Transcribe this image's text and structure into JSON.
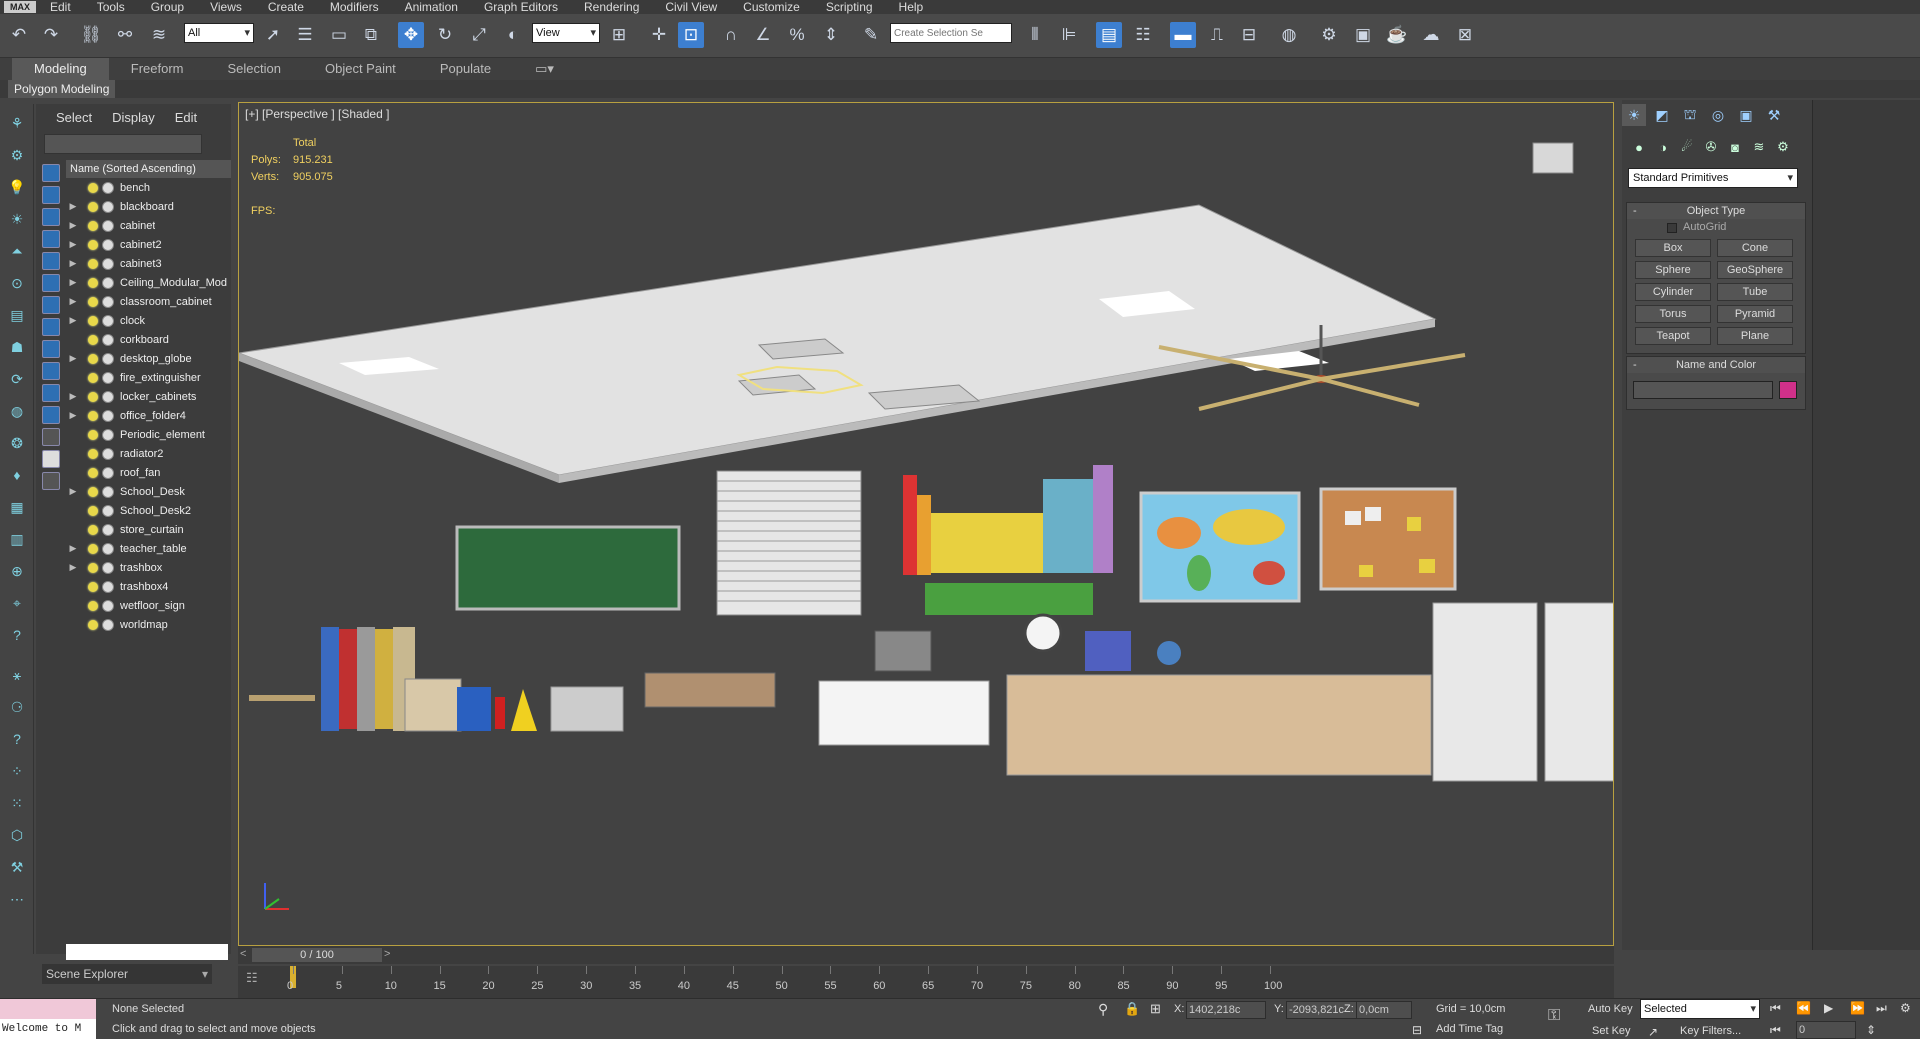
{
  "menu": {
    "logo": "MAX",
    "items": [
      "Edit",
      "Tools",
      "Group",
      "Views",
      "Create",
      "Modifiers",
      "Animation",
      "Graph Editors",
      "Rendering",
      "Civil View",
      "Customize",
      "Scripting",
      "Help"
    ]
  },
  "toolbar": {
    "filter_value": "All",
    "refcoord_value": "View",
    "selection_set_placeholder": "Create Selection Se"
  },
  "ribbon": {
    "tabs": [
      "Modeling",
      "Freeform",
      "Selection",
      "Object Paint",
      "Populate"
    ],
    "active": "Modeling",
    "sub_label": "Polygon Modeling"
  },
  "explorer": {
    "menu": [
      "Select",
      "Display",
      "Edit"
    ],
    "column_header": "Name (Sorted Ascending)",
    "items": [
      {
        "name": "bench",
        "expandable": false
      },
      {
        "name": "blackboard",
        "expandable": true
      },
      {
        "name": "cabinet",
        "expandable": true
      },
      {
        "name": "cabinet2",
        "expandable": true
      },
      {
        "name": "cabinet3",
        "expandable": true
      },
      {
        "name": "Ceiling_Modular_Mod",
        "expandable": true
      },
      {
        "name": "classroom_cabinet",
        "expandable": true
      },
      {
        "name": "clock",
        "expandable": true
      },
      {
        "name": "corkboard",
        "expandable": false
      },
      {
        "name": "desktop_globe",
        "expandable": true
      },
      {
        "name": "fire_extinguisher",
        "expandable": false
      },
      {
        "name": "locker_cabinets",
        "expandable": true
      },
      {
        "name": "office_folder4",
        "expandable": true
      },
      {
        "name": "Periodic_element",
        "expandable": false
      },
      {
        "name": "radiator2",
        "expandable": false
      },
      {
        "name": "roof_fan",
        "expandable": false
      },
      {
        "name": "School_Desk",
        "expandable": true
      },
      {
        "name": "School_Desk2",
        "expandable": false
      },
      {
        "name": "store_curtain",
        "expandable": false
      },
      {
        "name": "teacher_table",
        "expandable": true
      },
      {
        "name": "trashbox",
        "expandable": true
      },
      {
        "name": "trashbox4",
        "expandable": false
      },
      {
        "name": "wetfloor_sign",
        "expandable": false
      },
      {
        "name": "worldmap",
        "expandable": false
      }
    ],
    "footer_label": "Scene Explorer"
  },
  "viewport": {
    "label": "[+] [Perspective ] [Shaded ]",
    "stats_header": "Total",
    "polys_label": "Polys:",
    "polys_value": "915.231",
    "verts_label": "Verts:",
    "verts_value": "905.075",
    "fps_label": "FPS:"
  },
  "command_panel": {
    "primitives_value": "Standard Primitives",
    "object_type_title": "Object Type",
    "autogrid_label": "AutoGrid",
    "buttons": [
      "Box",
      "Cone",
      "Sphere",
      "GeoSphere",
      "Cylinder",
      "Tube",
      "Torus",
      "Pyramid",
      "Teapot",
      "Plane"
    ],
    "name_color_title": "Name and Color",
    "swatch_color": "#d0308a"
  },
  "timeline": {
    "frame_label": "0 / 100",
    "ticks": [
      0,
      5,
      10,
      15,
      20,
      25,
      30,
      35,
      40,
      45,
      50,
      55,
      60,
      65,
      70,
      75,
      80,
      85,
      90,
      95,
      100
    ]
  },
  "status": {
    "welcome": "Welcome to M",
    "selection": "None Selected",
    "prompt": "Click and drag to select and move objects",
    "x_label": "X:",
    "x_value": "1402,218c",
    "y_label": "Y:",
    "y_value": "-2093,821c",
    "z_label": "Z:",
    "z_value": "0,0cm",
    "grid": "Grid = 10,0cm",
    "add_time_tag": "Add Time Tag",
    "auto_key": "Auto Key",
    "set_key": "Set Key",
    "selected_value": "Selected",
    "key_filters": "Key Filters...",
    "frame_value": "0"
  }
}
